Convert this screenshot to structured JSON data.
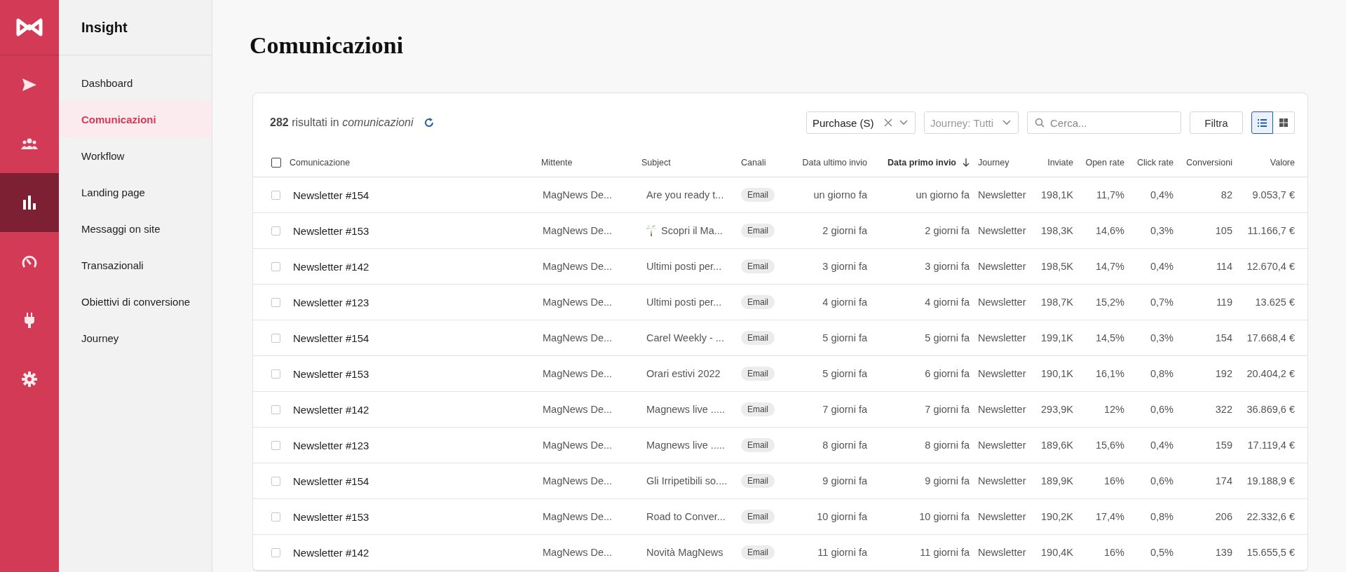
{
  "rail": {
    "items": [
      {
        "kind": "send",
        "selected": false
      },
      {
        "kind": "people",
        "selected": false
      },
      {
        "kind": "chart",
        "selected": true
      },
      {
        "kind": "gauge",
        "selected": false
      },
      {
        "kind": "plug",
        "selected": false
      },
      {
        "kind": "gear",
        "selected": false
      }
    ]
  },
  "sidebar": {
    "title": "Insight",
    "items": [
      {
        "label": "Dashboard",
        "selected": false
      },
      {
        "label": "Comunicazioni",
        "selected": true
      },
      {
        "label": "Workflow",
        "selected": false
      },
      {
        "label": "Landing page",
        "selected": false
      },
      {
        "label": "Messaggi on site",
        "selected": false
      },
      {
        "label": "Transazionali",
        "selected": false
      },
      {
        "label": "Obiettivi di conversione",
        "selected": false
      },
      {
        "label": "Journey",
        "selected": false
      }
    ]
  },
  "page_title": "Comunicazioni",
  "toolbar": {
    "results": "**282** risultati in *comunicazioni*",
    "type_filter": {
      "value": "Purchase (S)"
    },
    "journey_filter": {
      "placeholder": "Journey: Tutti"
    },
    "search": {
      "placeholder": "Cerca..."
    },
    "filter_button": "Filtra",
    "views": [
      {
        "kind": "list",
        "selected": true
      },
      {
        "kind": "grid",
        "selected": false
      }
    ]
  },
  "table": {
    "select_all_checked": false,
    "columns": [
      {
        "label": "Comunicazione",
        "sorted": false
      },
      {
        "label": "Mittente",
        "sorted": false
      },
      {
        "label": "Subject",
        "sorted": false
      },
      {
        "label": "Canali",
        "sorted": false
      },
      {
        "label": "Data ultimo invio",
        "sorted": false
      },
      {
        "label": "Data primo invio",
        "sorted": true
      },
      {
        "label": "Journey",
        "sorted": false
      },
      {
        "label": "Inviate",
        "sorted": false
      },
      {
        "label": "Open rate",
        "sorted": false
      },
      {
        "label": "Click rate",
        "sorted": false
      },
      {
        "label": "Conversioni",
        "sorted": false
      },
      {
        "label": "Valore",
        "sorted": false
      }
    ],
    "rows": [
      {
        "checked": false,
        "name": "Newsletter #154",
        "sender": "MagNews De...",
        "subject_icon": false,
        "subject": "Are you ready t...",
        "channel": "Email",
        "last_sent": "un giorno fa",
        "first_sent": "un giorno fa",
        "journey": "Newsletter",
        "sent": "198,1K",
        "open_rate": "11,7%",
        "click_rate": "0,4%",
        "conversions": "82",
        "value": "9.053,7 €"
      },
      {
        "checked": false,
        "name": "Newsletter #153",
        "sender": "MagNews De...",
        "subject_icon": true,
        "subject": "Scopri il Ma...",
        "channel": "Email",
        "last_sent": "2 giorni fa",
        "first_sent": "2 giorni fa",
        "journey": "Newsletter",
        "sent": "198,3K",
        "open_rate": "14,6%",
        "click_rate": "0,3%",
        "conversions": "105",
        "value": "11.166,7 €"
      },
      {
        "checked": false,
        "name": "Newsletter #142",
        "sender": "MagNews De...",
        "subject_icon": false,
        "subject": "Ultimi posti per...",
        "channel": "Email",
        "last_sent": "3 giorni fa",
        "first_sent": "3 giorni fa",
        "journey": "Newsletter",
        "sent": "198,5K",
        "open_rate": "14,7%",
        "click_rate": "0,4%",
        "conversions": "114",
        "value": "12.670,4 €"
      },
      {
        "checked": false,
        "name": "Newsletter #123",
        "sender": "MagNews De...",
        "subject_icon": false,
        "subject": "Ultimi posti per...",
        "channel": "Email",
        "last_sent": "4 giorni fa",
        "first_sent": "4 giorni fa",
        "journey": "Newsletter",
        "sent": "198,7K",
        "open_rate": "15,2%",
        "click_rate": "0,7%",
        "conversions": "119",
        "value": "13.625 €"
      },
      {
        "checked": false,
        "name": "Newsletter #154",
        "sender": "MagNews De...",
        "subject_icon": false,
        "subject": "Carel Weekly - ...",
        "channel": "Email",
        "last_sent": "5 giorni fa",
        "first_sent": "5 giorni fa",
        "journey": "Newsletter",
        "sent": "199,1K",
        "open_rate": "14,5%",
        "click_rate": "0,3%",
        "conversions": "154",
        "value": "17.668,4 €"
      },
      {
        "checked": false,
        "name": "Newsletter #153",
        "sender": "MagNews De...",
        "subject_icon": false,
        "subject": "Orari estivi 2022",
        "channel": "Email",
        "last_sent": "5 giorni fa",
        "first_sent": "6 giorni fa",
        "journey": "Newsletter",
        "sent": "190,1K",
        "open_rate": "16,1%",
        "click_rate": "0,8%",
        "conversions": "192",
        "value": "20.404,2 €"
      },
      {
        "checked": false,
        "name": "Newsletter #142",
        "sender": "MagNews De...",
        "subject_icon": false,
        "subject": "Magnews live .....",
        "channel": "Email",
        "last_sent": "7 giorni fa",
        "first_sent": "7 giorni fa",
        "journey": "Newsletter",
        "sent": "293,9K",
        "open_rate": "12%",
        "click_rate": "0,6%",
        "conversions": "322",
        "value": "36.869,6 €"
      },
      {
        "checked": false,
        "name": "Newsletter #123",
        "sender": "MagNews De...",
        "subject_icon": false,
        "subject": "Magnews live .....",
        "channel": "Email",
        "last_sent": "8 giorni fa",
        "first_sent": "8 giorni fa",
        "journey": "Newsletter",
        "sent": "189,6K",
        "open_rate": "15,6%",
        "click_rate": "0,4%",
        "conversions": "159",
        "value": "17.119,4 €"
      },
      {
        "checked": false,
        "name": "Newsletter #154",
        "sender": "MagNews De...",
        "subject_icon": false,
        "subject": "Gli Irripetibili so....",
        "channel": "Email",
        "last_sent": "9 giorni fa",
        "first_sent": "9 giorni fa",
        "journey": "Newsletter",
        "sent": "189,9K",
        "open_rate": "16%",
        "click_rate": "0,6%",
        "conversions": "174",
        "value": "19.188,9 €"
      },
      {
        "checked": false,
        "name": "Newsletter #153",
        "sender": "MagNews De...",
        "subject_icon": false,
        "subject": "Road to Conver...",
        "channel": "Email",
        "last_sent": "10 giorni fa",
        "first_sent": "10 giorni fa",
        "journey": "Newsletter",
        "sent": "190,2K",
        "open_rate": "17,4%",
        "click_rate": "0,8%",
        "conversions": "206",
        "value": "22.332,6 €"
      },
      {
        "checked": false,
        "name": "Newsletter #142",
        "sender": "MagNews De...",
        "subject_icon": false,
        "subject": "Novità MagNews",
        "channel": "Email",
        "last_sent": "11 giorni fa",
        "first_sent": "11 giorni fa",
        "journey": "Newsletter",
        "sent": "190,4K",
        "open_rate": "16%",
        "click_rate": "0,5%",
        "conversions": "139",
        "value": "15.655,5 €"
      }
    ]
  }
}
